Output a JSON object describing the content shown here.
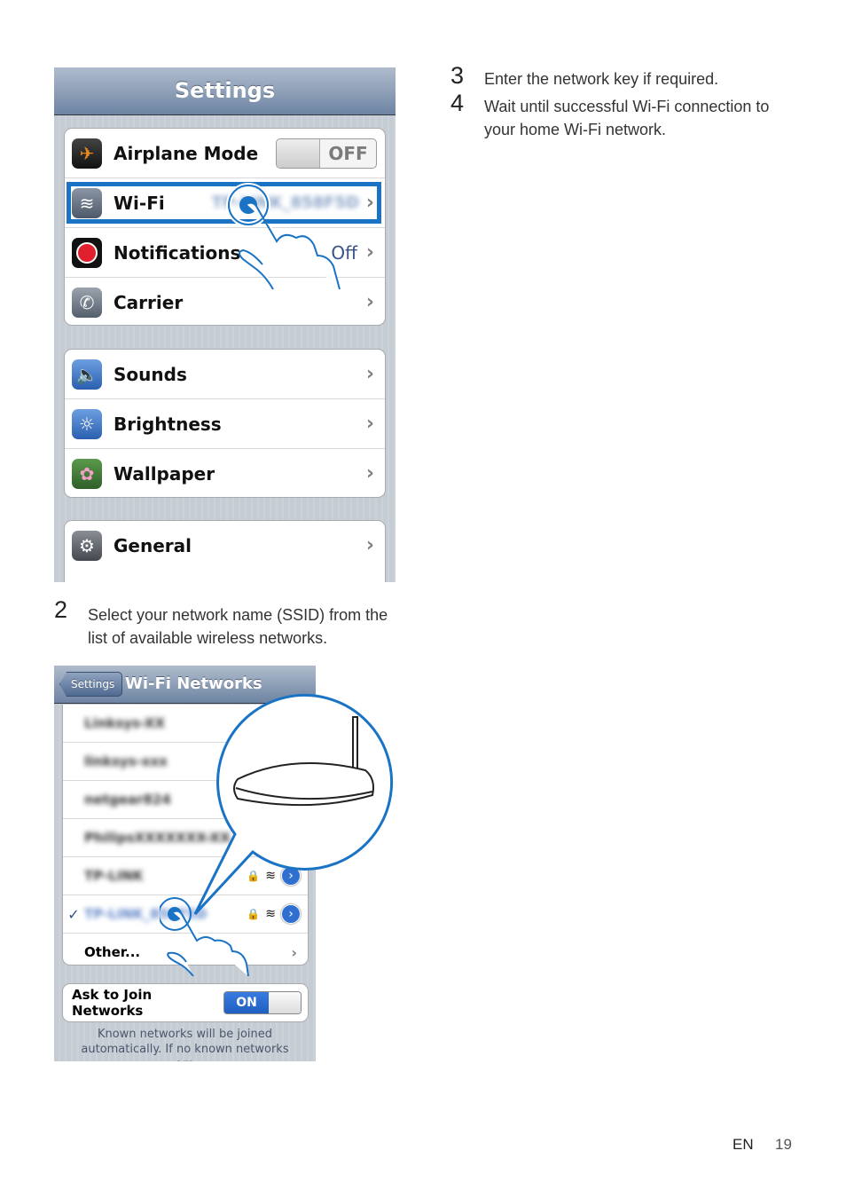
{
  "settings_screen": {
    "title": "Settings",
    "groups": [
      [
        {
          "label": "Airplane Mode",
          "icon": "airplane-icon",
          "toggle": "OFF"
        },
        {
          "label": "Wi-Fi",
          "icon": "wifi-icon",
          "value": "TP-LINK_858F5D",
          "selected": true
        },
        {
          "label": "Notifications",
          "icon": "notifications-icon",
          "value": "Off"
        },
        {
          "label": "Carrier",
          "icon": "phone-icon"
        }
      ],
      [
        {
          "label": "Sounds",
          "icon": "speaker-icon"
        },
        {
          "label": "Brightness",
          "icon": "brightness-icon"
        },
        {
          "label": "Wallpaper",
          "icon": "wallpaper-icon"
        }
      ],
      [
        {
          "label": "General",
          "icon": "gear-icon"
        }
      ]
    ]
  },
  "wifi_screen": {
    "back_label": "Settings",
    "title": "Wi-Fi Networks",
    "networks": [
      {
        "name": "Linksys-XX"
      },
      {
        "name": "linksys-xxx"
      },
      {
        "name": "netgear824"
      },
      {
        "name": "PhilipsXXXXXXX-XX..."
      },
      {
        "name": "TP-LINK",
        "locked": true
      },
      {
        "name": "TP-LINK_858F5D",
        "locked": true,
        "checked": true
      }
    ],
    "other_label": "Other...",
    "ask_join_label": "Ask to Join Networks",
    "ask_join_toggle": "ON",
    "footer_text": "Known networks will be joined automatically.  If no known networks are"
  },
  "steps": [
    {
      "num": "2",
      "text": "Select your network name (SSID) from the list of available wireless networks."
    },
    {
      "num": "3",
      "text": "Enter the network key if required."
    },
    {
      "num": "4",
      "text": "Wait until successful Wi-Fi connection to your home Wi-Fi network."
    }
  ],
  "footer": {
    "lang": "EN",
    "page": "19"
  },
  "colors": {
    "accent": "#1a73c4",
    "ios_bar": "#6d84a2",
    "ios_blue": "#1f6dd0"
  }
}
